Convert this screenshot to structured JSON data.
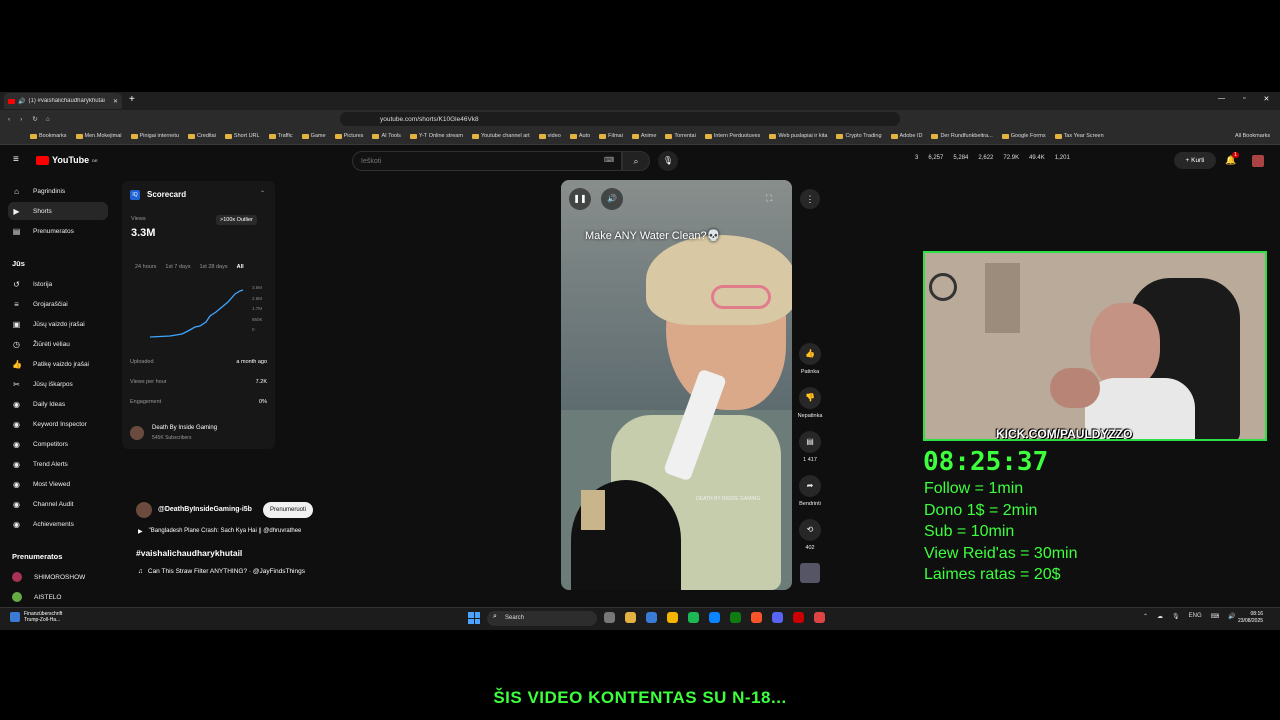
{
  "browser": {
    "tab_title": "(1) #vaishalichaudharykhutai",
    "url": "youtube.com/shorts/K10Gle46Vk8",
    "bookmarks": [
      "Bookmarks",
      "Men.Mokejimai",
      "Pinigai internetu",
      "Creditai",
      "Short URL",
      "Traffic",
      "Game",
      "Pictures",
      "AI Tools",
      "Y-T Online stream",
      "Youtube channel art",
      "video",
      "Auto",
      "Filmai",
      "Anime",
      "Torrentai",
      "Intern Perduotuves",
      "Web puslapiai ir kita",
      "Crypto Trading",
      "Adobe ID",
      "Der Rundfunkbeitra...",
      "Google Forms",
      "Tax Year Screen"
    ],
    "all_bookmarks": "All Bookmarks"
  },
  "youtube": {
    "logo": "YouTube",
    "region": "DE",
    "search_placeholder": "Ieškoti",
    "header_stats": [
      "3",
      "6,257",
      "5,284",
      "2,622",
      "72.9K",
      "49.4K",
      "1,201"
    ],
    "create_label": "Kurti",
    "notif_count": "1",
    "sidebar": [
      {
        "label": "Pagrindinis",
        "icon": "home-icon",
        "glyph": "⌂"
      },
      {
        "label": "Shorts",
        "icon": "shorts-icon",
        "glyph": "▶"
      },
      {
        "label": "Prenumeratos",
        "icon": "subscriptions-icon",
        "glyph": "▤"
      }
    ],
    "you_title": "Jūs",
    "you_items": [
      {
        "label": "Istorija",
        "icon": "history-icon",
        "glyph": "↺"
      },
      {
        "label": "Grojaraščiai",
        "icon": "playlist-icon",
        "glyph": "≡"
      },
      {
        "label": "Jūsų vaizdo įrašai",
        "icon": "video-icon",
        "glyph": "▣"
      },
      {
        "label": "Žiūrėti vėliau",
        "icon": "clock-icon",
        "glyph": "◷"
      },
      {
        "label": "Patikę vaizdo įrašai",
        "icon": "like-icon",
        "glyph": "👍"
      },
      {
        "label": "Jūsų iškarpos",
        "icon": "scissors-icon",
        "glyph": "✂"
      },
      {
        "label": "Daily Ideas",
        "icon": "vidiq-icon",
        "glyph": "◉"
      },
      {
        "label": "Keyword Inspector",
        "icon": "vidiq-icon",
        "glyph": "◉"
      },
      {
        "label": "Competitors",
        "icon": "vidiq-icon",
        "glyph": "◉"
      },
      {
        "label": "Trend Alerts",
        "icon": "vidiq-icon",
        "glyph": "◉"
      },
      {
        "label": "Most Viewed",
        "icon": "vidiq-icon",
        "glyph": "◉"
      },
      {
        "label": "Channel Audit",
        "icon": "vidiq-icon",
        "glyph": "◉"
      },
      {
        "label": "Achievements",
        "icon": "vidiq-icon",
        "glyph": "◉"
      }
    ],
    "subs_title": "Prenumeratos",
    "subs": [
      "SHIMOROSHOW",
      "AISTELO"
    ]
  },
  "scorecard": {
    "title": "Scorecard",
    "views_label": "Views",
    "views_value": "3.3M",
    "badge": ">100x Outlier",
    "ranges": [
      "24 hours",
      "1st 7 days",
      "1st 28 days",
      "All"
    ],
    "y_ticks": [
      "3.6M",
      "2.6M",
      "1.7M",
      "850K",
      "0"
    ],
    "rows": [
      {
        "label": "Uploaded",
        "value": "a month ago"
      },
      {
        "label": "Views per hour",
        "value": "7.2K"
      },
      {
        "label": "Engagement",
        "value": "0%"
      }
    ],
    "channel": "Death By Inside Gaming",
    "channel_subs": "545K Subscribers"
  },
  "short": {
    "overlay_title": "Make ANY Water Clean?💀",
    "watermark": "DEATH BY INSIDE GAMING",
    "like_label": "Patinka",
    "dislike_label": "Nepatinka",
    "comments": "1 417",
    "share_label": "Bendrinti",
    "remix": "402",
    "channel_handle": "@DeathByInsideGaming-i5b",
    "subscribe_label": "Prenumeruoti",
    "related": "\"Bangladesh Plane Crash: Sach Kya Hai || @dhruvrathee",
    "hashtag": "#vaishalichaudharykhutail",
    "music": "Can This Straw Filter ANYTHING? · @JayFindsThings"
  },
  "stream": {
    "kick": "KICK.COM/PAULDYZZO",
    "timer": "08:25:37",
    "rules": [
      "Follow = 1min",
      "Dono 1$ = 2min",
      "Sub = 10min",
      "View Reid'as = 30min",
      "Laimes ratas = 20$"
    ],
    "banner": "ŠIS VIDEO KONTENTAS SU N-18..."
  },
  "taskbar": {
    "news": "Finanzüberschrift",
    "news_sub": "Trump-Zoll-Ha...",
    "search": "Search",
    "lang": "ENG",
    "time": "08:16",
    "date": "23/08/2025"
  }
}
